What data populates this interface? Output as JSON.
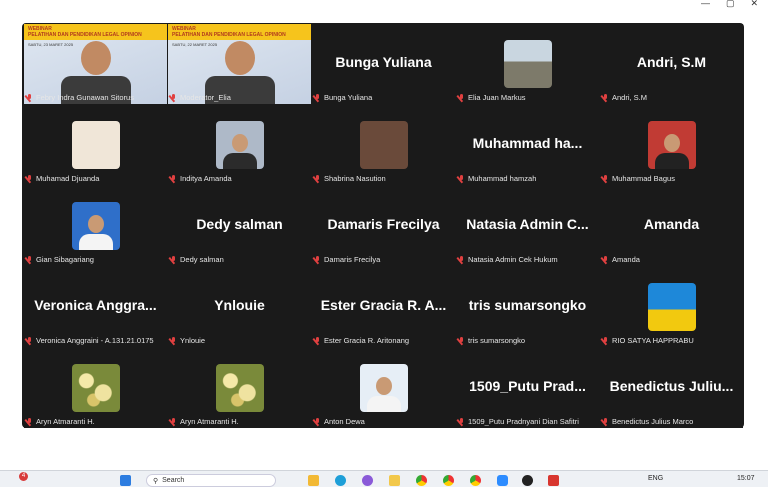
{
  "window_controls": [
    "—",
    "▢",
    "✕"
  ],
  "tiles": [
    {
      "name": "Febry Indra Gunawan Sitorus",
      "type": "webinar",
      "active": true,
      "webinar_title": "WEBINAR",
      "webinar_sub": "PELATIHAN DAN PENDIDIKAN LEGAL OPINION",
      "webinar_date": "SABTU, 23 MARET 2025"
    },
    {
      "name": "Moderator_Elia",
      "type": "webinar",
      "active": false,
      "webinar_title": "WEBINAR",
      "webinar_sub": "PELATIHAN DAN PENDIDIKAN LEGAL OPINION",
      "webinar_date": "SABTU, 22 MARET 2025"
    },
    {
      "name": "Bunga Yuliana",
      "type": "name",
      "display": "Bunga Yuliana"
    },
    {
      "name": "Elia Juan Markus",
      "type": "avatar",
      "avatar": "outdoor"
    },
    {
      "name": "Andri, S.M",
      "type": "name",
      "display": "Andri, S.M"
    },
    {
      "name": "Muhamad Djuanda",
      "type": "avatar",
      "avatar": "cat"
    },
    {
      "name": "Inditya Amanda",
      "type": "avatar",
      "avatar": "lady"
    },
    {
      "name": "Shabrina Nasution",
      "type": "avatar",
      "avatar": "girl"
    },
    {
      "name": "Muhammad hamzah",
      "type": "name",
      "display": "Muhammad ha..."
    },
    {
      "name": "Muhammad Bagus",
      "type": "avatar",
      "avatar": "man-red"
    },
    {
      "name": "Gian Sibagariang",
      "type": "avatar",
      "avatar": "man-blue"
    },
    {
      "name": "Dedy salman",
      "type": "name",
      "display": "Dedy salman"
    },
    {
      "name": "Damaris Frecilya",
      "type": "name",
      "display": "Damaris Frecilya"
    },
    {
      "name": "Natasia Admin Cek Hukum",
      "type": "name",
      "display": "Natasia Admin C..."
    },
    {
      "name": "Amanda",
      "type": "name",
      "display": "Amanda"
    },
    {
      "name": "Veronica Anggraini - A.131.21.0175",
      "type": "name",
      "display": "Veronica Anggra..."
    },
    {
      "name": "Ynlouie",
      "type": "name",
      "display": "Ynlouie"
    },
    {
      "name": "Ester Gracia R. Aritonang",
      "type": "name",
      "display": "Ester Gracia R. A..."
    },
    {
      "name": "tris sumarsongko",
      "type": "name",
      "display": "tris sumarsongko"
    },
    {
      "name": "RIO SATYA HAPPRABU",
      "type": "avatar",
      "avatar": "sketch"
    },
    {
      "name": "Aryn Atmaranti H.",
      "type": "avatar",
      "avatar": "flower"
    },
    {
      "name": "Aryn Atmaranti H.",
      "type": "avatar",
      "avatar": "flower"
    },
    {
      "name": "Anton Dewa",
      "type": "avatar",
      "avatar": "white"
    },
    {
      "name": "1509_Putu Pradnyani Dian Safitri",
      "type": "name",
      "display": "1509_Putu Prad..."
    },
    {
      "name": "Benedictus Julius Marco",
      "type": "name",
      "display": "Benedictus Juliu..."
    }
  ],
  "taskbar": {
    "notification_count": "4",
    "search_placeholder": "Search",
    "language": "ENG",
    "time": "15:07"
  },
  "colors": {
    "active_border": "#27c26b",
    "mic_muted": "#e04040",
    "tile_bg": "#1a1a1a"
  }
}
